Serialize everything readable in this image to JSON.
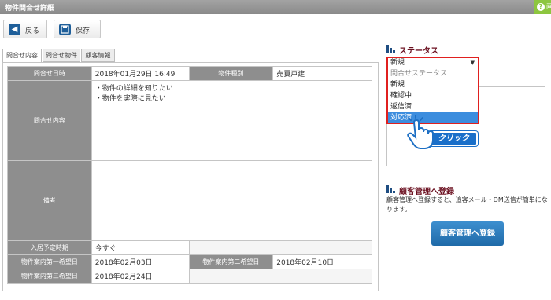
{
  "window": {
    "title": "物件問合せ詳細",
    "help_label": "画",
    "help_icon": "question-circle-icon"
  },
  "toolbar": {
    "back_label": "戻る",
    "save_label": "保存"
  },
  "tabs": [
    {
      "label": "問合せ内容",
      "active": true
    },
    {
      "label": "問合せ物件",
      "active": false
    },
    {
      "label": "顧客情報",
      "active": false
    }
  ],
  "inquiry": {
    "date_label": "問合せ日時",
    "date_value": "2018年01月29日 16:49",
    "type_label": "物件種別",
    "type_value": "売買戸建",
    "content_label": "問合せ内容",
    "content_lines": [
      "・物件の詳細を知りたい",
      "・物件を実際に見たい"
    ],
    "note_label": "備考",
    "note_value": "",
    "movein_label": "入居予定時期",
    "movein_value": "今すぐ",
    "wish1_label": "物件案内第一希望日",
    "wish1_value": "2018年02月03日",
    "wish2_label": "物件案内第二希望日",
    "wish2_value": "2018年02月10日",
    "wish3_label": "物件案内第三希望日",
    "wish3_value": "2018年02月24日"
  },
  "status": {
    "heading": "ステータス",
    "selected_value": "新規",
    "options": [
      "問合せステータス",
      "新規",
      "確認中",
      "返信済",
      "対応済"
    ],
    "highlighted_option": "対応済"
  },
  "click_badge": "クリック",
  "crm": {
    "heading": "顧客管理へ登録",
    "description": "顧客管理へ登録すると、追客メール・DM送信が簡単になります。",
    "button_label": "顧客管理へ登録"
  },
  "colors": {
    "accent_red": "#e0201f",
    "primary_blue": "#1f6aa8",
    "highlight_blue": "#3c8dde",
    "heading_maroon": "#6b1020",
    "header_gray": "#8e8e8e"
  }
}
